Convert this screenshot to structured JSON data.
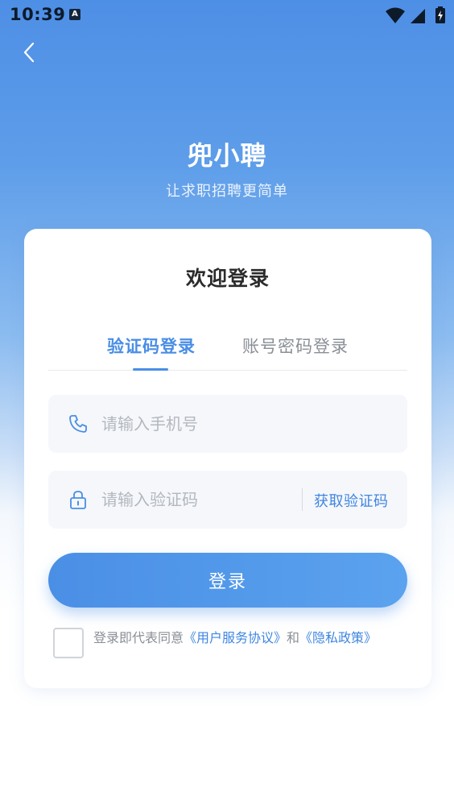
{
  "status_bar": {
    "time": "10:39",
    "notif_badge": "A"
  },
  "header": {
    "app_name": "兜小聘",
    "slogan": "让求职招聘更简单"
  },
  "card": {
    "welcome": "欢迎登录",
    "tabs": [
      {
        "label": "验证码登录",
        "active": true
      },
      {
        "label": "账号密码登录",
        "active": false
      }
    ],
    "phone_input": {
      "placeholder": "请输入手机号",
      "value": ""
    },
    "code_input": {
      "placeholder": "请输入验证码",
      "value": ""
    },
    "get_code_label": "获取验证码",
    "login_label": "登录",
    "agreement": {
      "prefix": "登录即代表同意",
      "terms": "《用户服务协议》",
      "and": "和",
      "privacy": "《隐私政策》"
    }
  },
  "icons": [
    "back-chevron-icon",
    "phone-icon",
    "lock-icon",
    "wifi-icon",
    "signal-icon",
    "battery-icon"
  ],
  "colors": {
    "accent": "#4a8ee5",
    "link": "#3f86e0",
    "header_bg": "#4e8fe6"
  }
}
